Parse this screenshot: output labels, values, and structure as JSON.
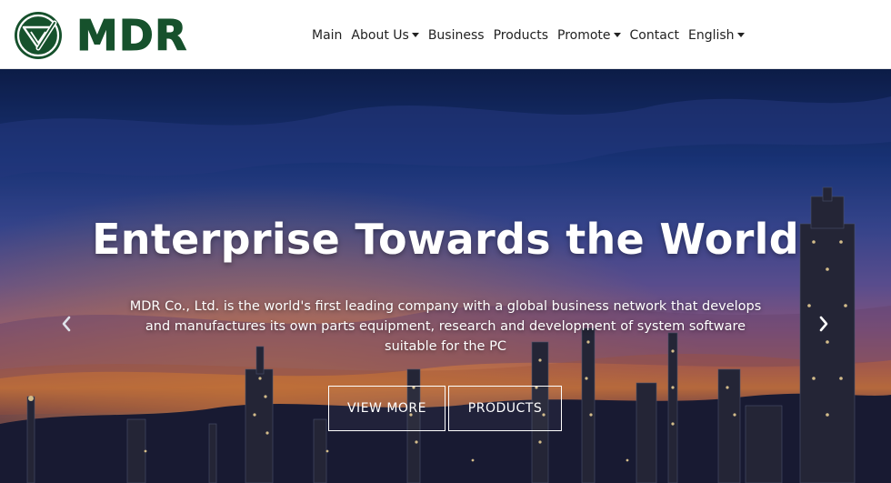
{
  "brand": {
    "name": "MDR",
    "color": "#16512c"
  },
  "nav": {
    "items": [
      {
        "label": "Main",
        "dropdown": false
      },
      {
        "label": "About Us",
        "dropdown": true
      },
      {
        "label": "Business",
        "dropdown": false
      },
      {
        "label": "Products",
        "dropdown": false
      },
      {
        "label": "Promote",
        "dropdown": true
      },
      {
        "label": "Contact",
        "dropdown": false
      },
      {
        "label": "English",
        "dropdown": true
      }
    ]
  },
  "hero": {
    "title": "Enterprise Towards the World",
    "description": "MDR Co., Ltd. is the world's first leading company with a global business network that develops and manufactures its own parts equipment, research and development of system software suitable for the PC",
    "buttons": {
      "view_more": "VIEW MORE",
      "products": "PRODUCTS"
    },
    "prev_icon": "chevron-left-icon",
    "next_icon": "chevron-right-icon"
  }
}
